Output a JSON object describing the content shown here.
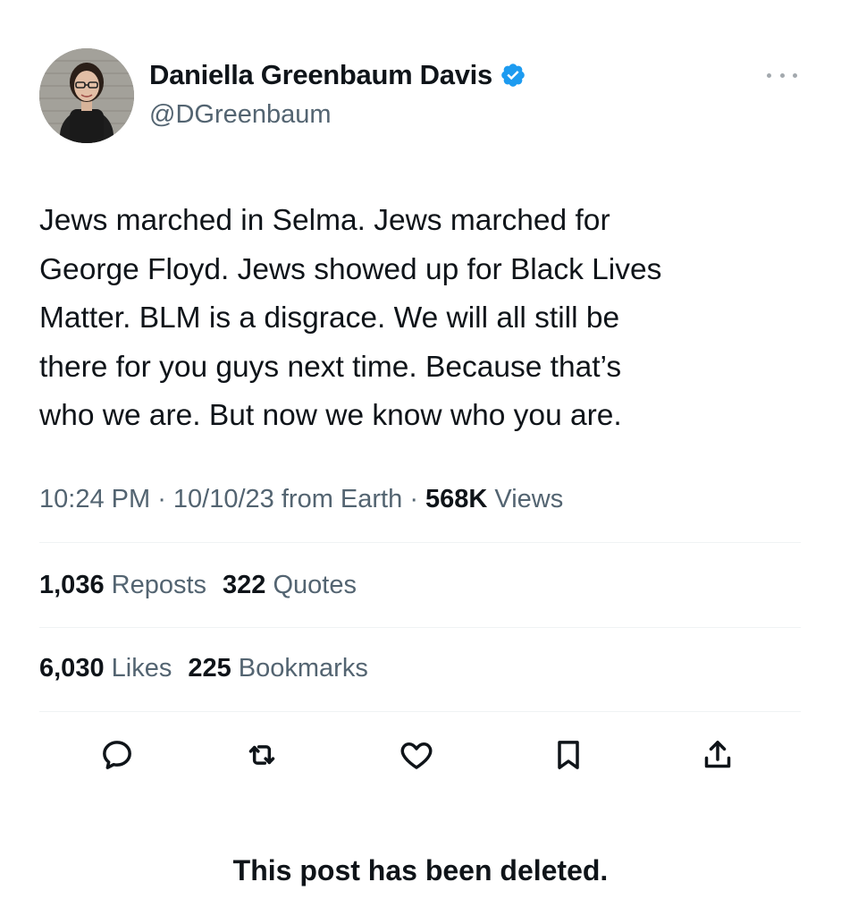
{
  "author": {
    "display_name": "Daniella Greenbaum Davis",
    "handle": "@DGreenbaum",
    "verified": true,
    "verified_color": "#1d9bf0"
  },
  "tweet": {
    "text_lines": [
      "Jews marched in Selma. Jews marched for",
      "George Floyd. Jews showed up for Black Lives",
      "Matter. BLM is a disgrace. We will all still be",
      "there for you guys next time. Because that’s",
      "who we are. But now we know who you are."
    ],
    "time": "10:24 PM",
    "date": "10/10/23",
    "source": "from Earth",
    "views_count": "568K",
    "views_label": "Views"
  },
  "stats": {
    "reposts_count": "1,036",
    "reposts_label": "Reposts",
    "quotes_count": "322",
    "quotes_label": "Quotes",
    "likes_count": "6,030",
    "likes_label": "Likes",
    "bookmarks_count": "225",
    "bookmarks_label": "Bookmarks"
  },
  "actions": [
    "reply-icon",
    "repost-icon",
    "like-icon",
    "bookmark-icon",
    "share-icon"
  ],
  "footer": {
    "deleted_notice": "This post has been deleted."
  },
  "colors": {
    "text_primary": "#0f1419",
    "text_secondary": "#536471",
    "divider": "#eff3f4"
  }
}
